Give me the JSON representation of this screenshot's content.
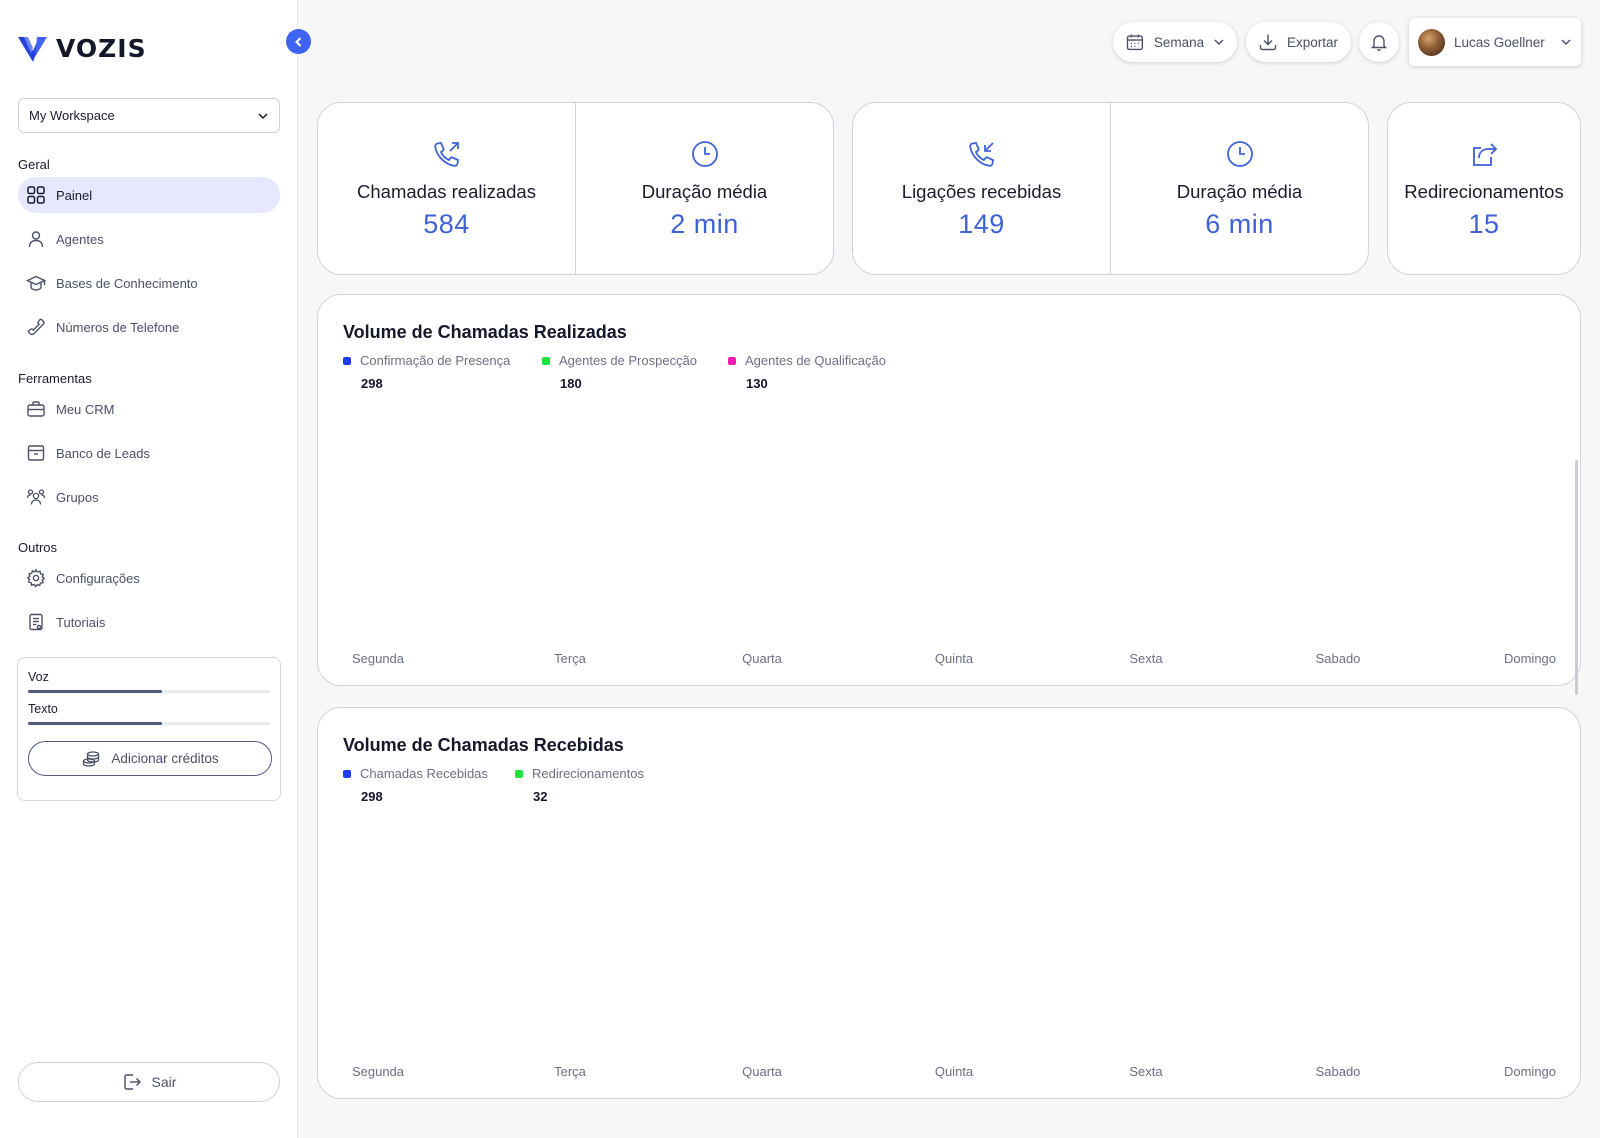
{
  "brand": {
    "name": "VOZIS",
    "accent": "#3f63f2"
  },
  "sidebar": {
    "workspace": "My Workspace",
    "sections": {
      "geral": "Geral",
      "ferramentas": "Ferramentas",
      "outros": "Outros"
    },
    "items": [
      {
        "label": "Painel",
        "icon": "grid-icon",
        "active": true
      },
      {
        "label": "Agentes",
        "icon": "user-icon"
      },
      {
        "label": "Bases de Conhecimento",
        "icon": "graduation-cap-icon"
      },
      {
        "label": "Números de Telefone",
        "icon": "phone-icon"
      },
      {
        "label": "Meu CRM",
        "icon": "briefcase-icon"
      },
      {
        "label": "Banco de Leads",
        "icon": "archive-icon"
      },
      {
        "label": "Grupos",
        "icon": "users-icon"
      },
      {
        "label": "Configurações",
        "icon": "gear-icon"
      },
      {
        "label": "Tutoriais",
        "icon": "document-icon"
      }
    ],
    "credits": {
      "voice_label": "Voz",
      "voice_level": 0.55,
      "text_label": "Texto",
      "text_level": 0.55,
      "add_label": "Adicionar créditos"
    },
    "logout_label": "Sair"
  },
  "topbar": {
    "period": "Semana",
    "export": "Exportar",
    "user_name": "Lucas Goellner"
  },
  "stats": [
    {
      "title": "Chamadas realizadas",
      "value": "584",
      "icon": "phone-outgoing-icon"
    },
    {
      "title": "Duração média",
      "value": "2 min",
      "icon": "clock-icon"
    },
    {
      "title": "Ligações recebidas",
      "value": "149",
      "icon": "phone-incoming-icon"
    },
    {
      "title": "Duração média",
      "value": "6 min",
      "icon": "clock-icon"
    },
    {
      "title": "Redirecionamentos",
      "value": "15",
      "icon": "share-icon"
    }
  ],
  "chart_data": [
    {
      "type": "bar",
      "title": "Volume de Chamadas Realizadas",
      "categories": [
        "Segunda",
        "Terça",
        "Quarta",
        "Quinta",
        "Sexta",
        "Sabado",
        "Domingo"
      ],
      "series": [
        {
          "name": "Confirmação de Presença",
          "total": "298",
          "color": "#1f3df5"
        },
        {
          "name": "Agentes de Prospecção",
          "total": "180",
          "color": "#22e33a"
        },
        {
          "name": "Agentes de Qualificação",
          "total": "130",
          "color": "#f01ab4"
        }
      ],
      "grid": false,
      "legend": "top-left"
    },
    {
      "type": "bar",
      "title": "Volume de Chamadas Recebidas",
      "categories": [
        "Segunda",
        "Terça",
        "Quarta",
        "Quinta",
        "Sexta",
        "Sabado",
        "Domingo"
      ],
      "series": [
        {
          "name": "Chamadas Recebidas",
          "total": "298",
          "color": "#1f3df5"
        },
        {
          "name": "Redirecionamentos",
          "total": "32",
          "color": "#22e33a"
        }
      ],
      "grid": false,
      "legend": "top-left"
    }
  ]
}
